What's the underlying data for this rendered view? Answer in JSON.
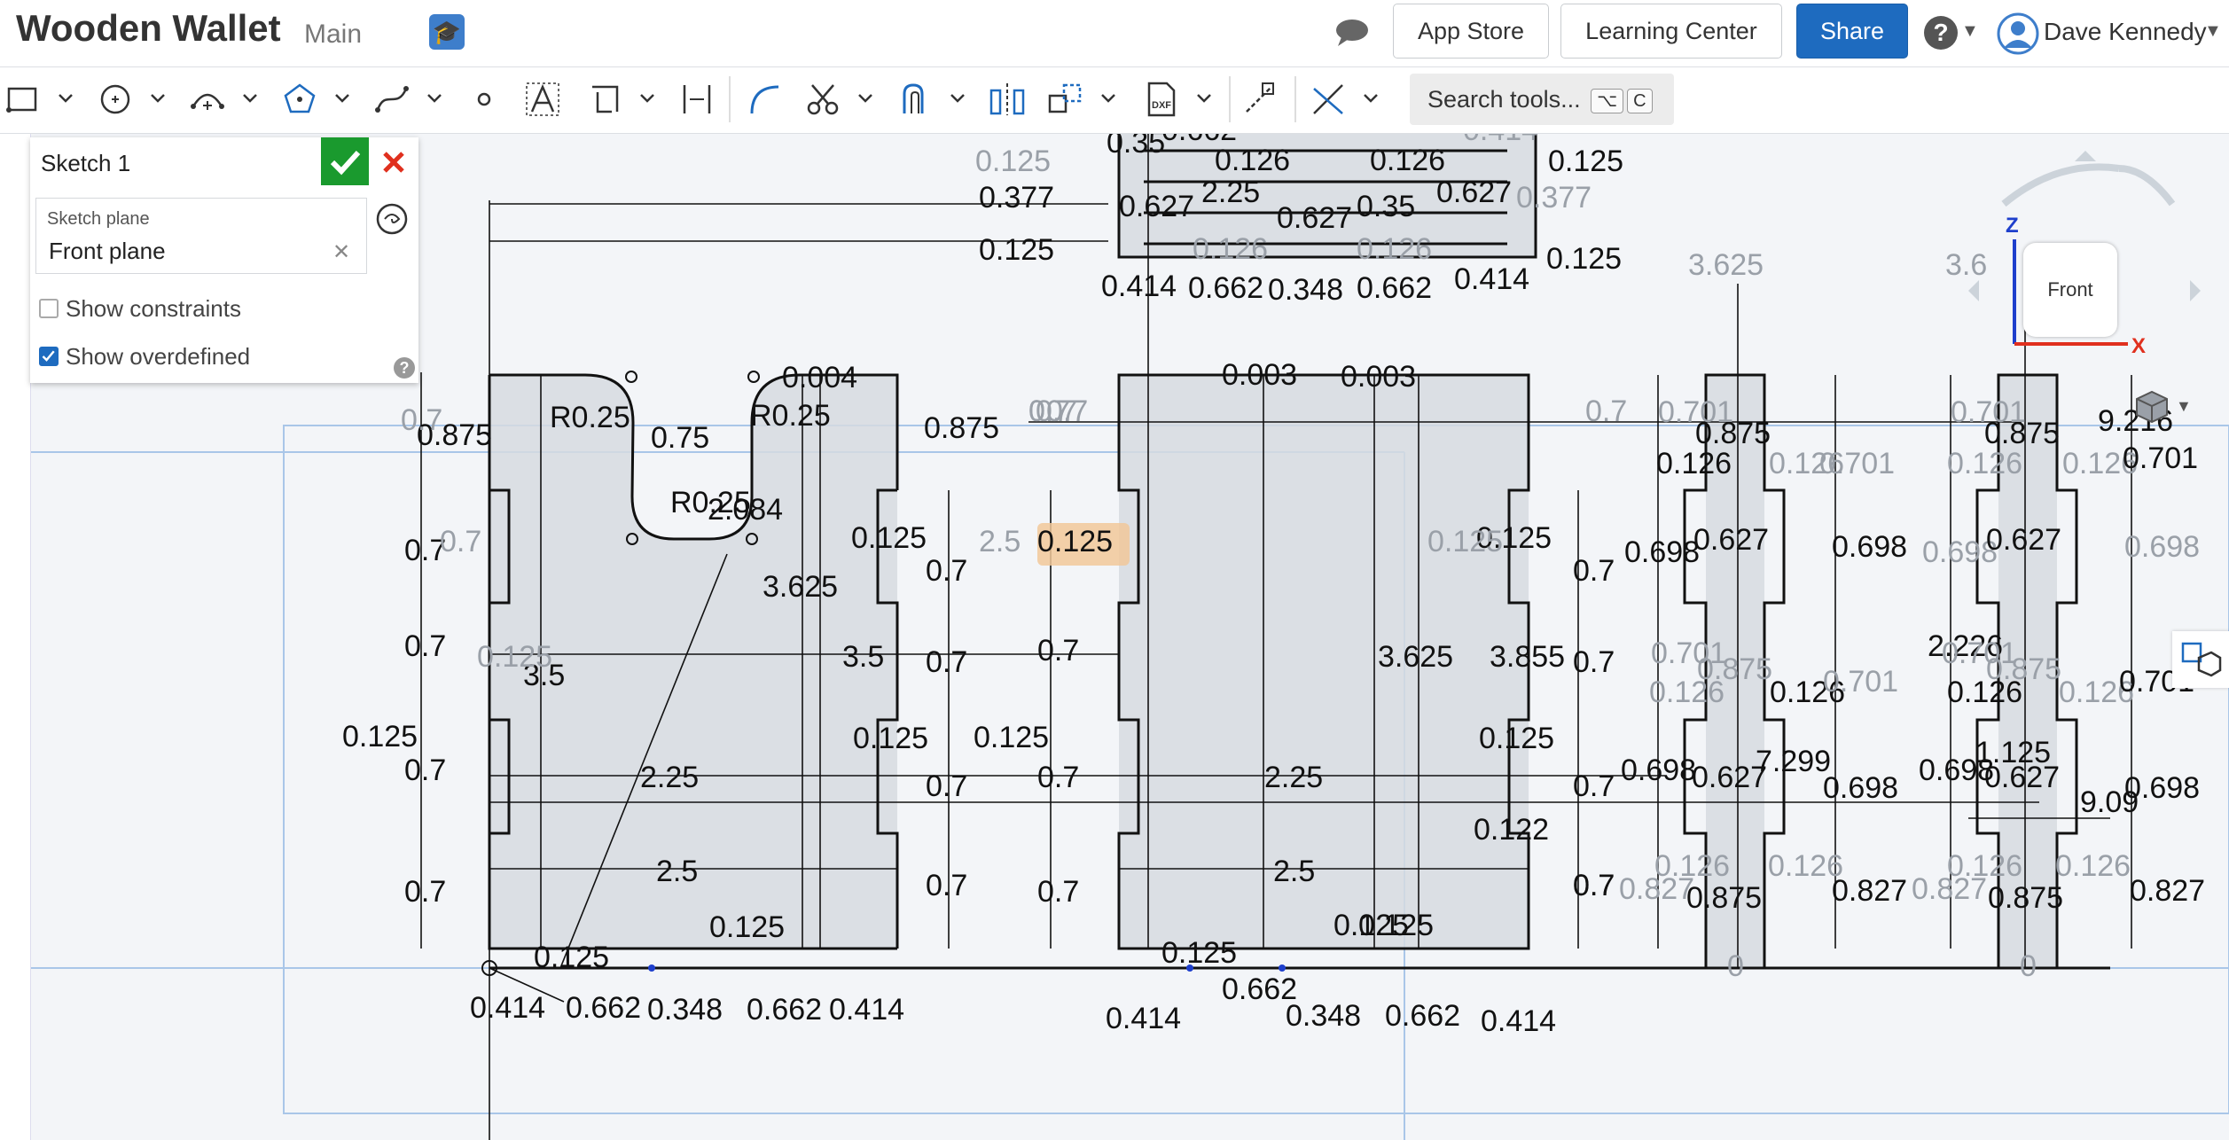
{
  "header": {
    "doc_title": "Wooden Wallet",
    "branch": "Main",
    "app_store": "App Store",
    "learning_center": "Learning Center",
    "share": "Share",
    "user_name": "Dave Kennedy"
  },
  "toolbar": {
    "search_label": "Search tools...",
    "shortcut_keys": [
      "⌥",
      "C"
    ]
  },
  "sketch_panel": {
    "title": "Sketch 1",
    "plane_label": "Sketch plane",
    "plane_value": "Front plane",
    "show_constraints": "Show constraints",
    "show_constraints_checked": false,
    "show_overdefined": "Show overdefined",
    "show_overdefined_checked": true
  },
  "viewcube": {
    "face": "Front",
    "axis_z": "Z",
    "axis_x": "X"
  },
  "colors": {
    "share_blue": "#1e6bbf",
    "confirm_green": "#1a9a2e",
    "cancel_red": "#e0301e",
    "sketch_line": "#111111",
    "region_fill": "#d6dae0",
    "construction_blue": "#a9c6e8",
    "dimension_grey": "#9aa0a8"
  },
  "dimensions": {
    "top": [
      "0.125",
      "0.35",
      "0.662",
      "0.126",
      "0.126",
      "0.414",
      "0.125",
      "0.377",
      "0.627",
      "2.25",
      "0.627",
      "0.35",
      "0.627",
      "0.377",
      "0.125",
      "0.126",
      "0.126",
      "0.125",
      "0.414",
      "0.662",
      "0.348",
      "0.662",
      "0.414"
    ],
    "left_part": [
      "0.875",
      "R0.25",
      "0.75",
      "R0.25",
      "0.004",
      "0.875",
      "R0.25",
      "2.084",
      "0.7",
      "0.7",
      "0.7",
      "0.7",
      "0.7",
      "0.125",
      "0.125",
      "3.5",
      "3.625",
      "3.5",
      "0.125",
      "0.7",
      "2.25",
      "0.7",
      "2.5",
      "0.7",
      "0.125",
      "0.125",
      "0.414",
      "0.662",
      "0.348",
      "0.662",
      "0.414"
    ],
    "middle_part": [
      "0.7",
      "0.7",
      "0.125",
      "0.7",
      "0.7",
      "0.7",
      "0.7",
      "0.125",
      "0.7",
      "0.7",
      "0.003",
      "0.003",
      "3.625",
      "3.855",
      "2.25",
      "2.5",
      "0.125",
      "0.125",
      "0.125",
      "0.7",
      "0.7",
      "0.7",
      "0.122",
      "0.125",
      "0.125",
      "0.414",
      "0.662",
      "0.348",
      "0.662",
      "0.414"
    ],
    "right_part_a": [
      "3.625",
      "0.701",
      "0.875",
      "0.126",
      "0.126",
      "0.701",
      "0.698",
      "0.627",
      "0.698",
      "0.701",
      "0.875",
      "0.126",
      "0.126",
      "0.701",
      "0.698",
      "0.627",
      "7.299",
      "0.698",
      "0.126",
      "0.126",
      "0.827",
      "0.875",
      "0.827",
      "0"
    ],
    "right_part_b": [
      "3.6",
      "0.701",
      "9.216",
      "0.875",
      "0.126",
      "0.126",
      "0.701",
      "0.698",
      "0.627",
      "0.698",
      "2.226",
      "0.701",
      "0.875",
      "0.126",
      "0.126",
      "0.701",
      "1.125",
      "0.698",
      "0.627",
      "9.09",
      "0.698",
      "0.126",
      "0.126",
      "0.827",
      "0.875",
      "0.827",
      "0"
    ],
    "faded": [
      "0.7",
      "0.7",
      "0.7",
      "0.7",
      "0.125",
      "2.5",
      "0.125"
    ]
  }
}
